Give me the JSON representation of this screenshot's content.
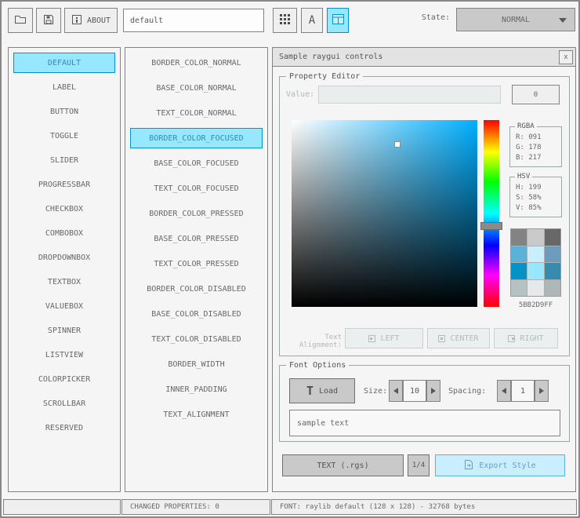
{
  "toolbar": {
    "file_name": "default",
    "about_label": "ABOUT",
    "state_label": "State:",
    "state_value": "NORMAL"
  },
  "controls": {
    "selected_index": 0,
    "items": [
      "DEFAULT",
      "LABEL",
      "BUTTON",
      "TOGGLE",
      "SLIDER",
      "PROGRESSBAR",
      "CHECKBOX",
      "COMBOBOX",
      "DROPDOWNBOX",
      "TEXTBOX",
      "VALUEBOX",
      "SPINNER",
      "LISTVIEW",
      "COLORPICKER",
      "SCROLLBAR",
      "RESERVED"
    ]
  },
  "properties": {
    "selected_index": 3,
    "items": [
      "BORDER_COLOR_NORMAL",
      "BASE_COLOR_NORMAL",
      "TEXT_COLOR_NORMAL",
      "BORDER_COLOR_FOCUSED",
      "BASE_COLOR_FOCUSED",
      "TEXT_COLOR_FOCUSED",
      "BORDER_COLOR_PRESSED",
      "BASE_COLOR_PRESSED",
      "TEXT_COLOR_PRESSED",
      "BORDER_COLOR_DISABLED",
      "BASE_COLOR_DISABLED",
      "TEXT_COLOR_DISABLED",
      "BORDER_WIDTH",
      "INNER_PADDING",
      "TEXT_ALIGNMENT"
    ]
  },
  "sample_window": {
    "title": "Sample raygui controls",
    "close_label": "x",
    "property_editor": {
      "title": "Property Editor",
      "value_label": "Value:",
      "value_text": "",
      "value_button_label": "0",
      "rgba": {
        "title": "RGBA",
        "r": "R: 091",
        "g": "G: 178",
        "b": "B: 217"
      },
      "hsv": {
        "title": "HSV",
        "h": "H: 199",
        "s": "S: 58%",
        "v": "V: 85%"
      },
      "hex_value": "5BB2D9FF",
      "palette": [
        "#838383",
        "#c9c9c9",
        "#686868",
        "#5bb2d9",
        "#c9effe",
        "#6c9bbc",
        "#0492c7",
        "#97e8ff",
        "#368baf",
        "#b5c1c2",
        "#e6e9e9",
        "#aeb7b8"
      ],
      "alignment": {
        "label": "Text Alignment:",
        "left": "LEFT",
        "center": "CENTER",
        "right": "RIGHT"
      }
    },
    "font_options": {
      "title": "Font Options",
      "load_icon": "T",
      "load_label": "Load",
      "size_label": "Size:",
      "size_value": "10",
      "spacing_label": "Spacing:",
      "spacing_value": "1",
      "sample_text": "sample text"
    },
    "footer": {
      "text_rgs_label": "TEXT (.rgs)",
      "page_label": "1/4",
      "export_label": "Export Style"
    }
  },
  "statusbar": {
    "left": "",
    "changed_properties": "CHANGED PROPERTIES: 0",
    "font_info": "FONT: raylib default (128 x 128) - 32768 bytes"
  },
  "colors": {
    "selected_base": "#97e8ff",
    "selected_border": "#0492c7",
    "selected_text": "#368baf",
    "focused_base": "#c9effe",
    "focused_border": "#5bb2d9",
    "focused_text": "#6c9bbc",
    "picker_hex": "#5bb2d9"
  }
}
